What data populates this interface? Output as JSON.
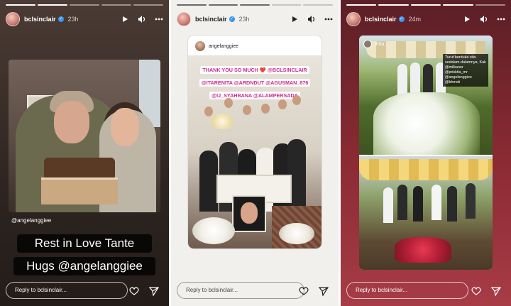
{
  "stories": [
    {
      "username": "bclsinclair",
      "time": "23h",
      "tagged_account": "@angelanggiee",
      "caption_line1": "Rest in Love Tante",
      "caption_line2": "Hugs @angelanggiee",
      "reply_placeholder": "Reply to bclsinclair..."
    },
    {
      "shared_from": "angelanggiee",
      "tags": [
        "THANK YOU SO MUCH ❤️ @BCLSINCLAIR",
        "@ITARENITA @ARDNDUT @AGUSMAN_876",
        "@IJ_SYAHBANA @ALAMPERSADA"
      ],
      "reply_placeholder": "Reply to bclsinclair..."
    },
    {
      "username": "bclsinclair",
      "time": "24m",
      "shared_from": "ih0a",
      "caption": "Turut berduka cita sedalam-dalamnya, Kak @milkaner @prisktia_mr @angelanggiee @bhmsti",
      "reply_placeholder": "Reply to bclsinclair..."
    }
  ],
  "icons": {
    "play": "play-icon",
    "volume": "volume-icon",
    "more": "more-icon",
    "like": "heart-icon",
    "share": "send-icon"
  }
}
